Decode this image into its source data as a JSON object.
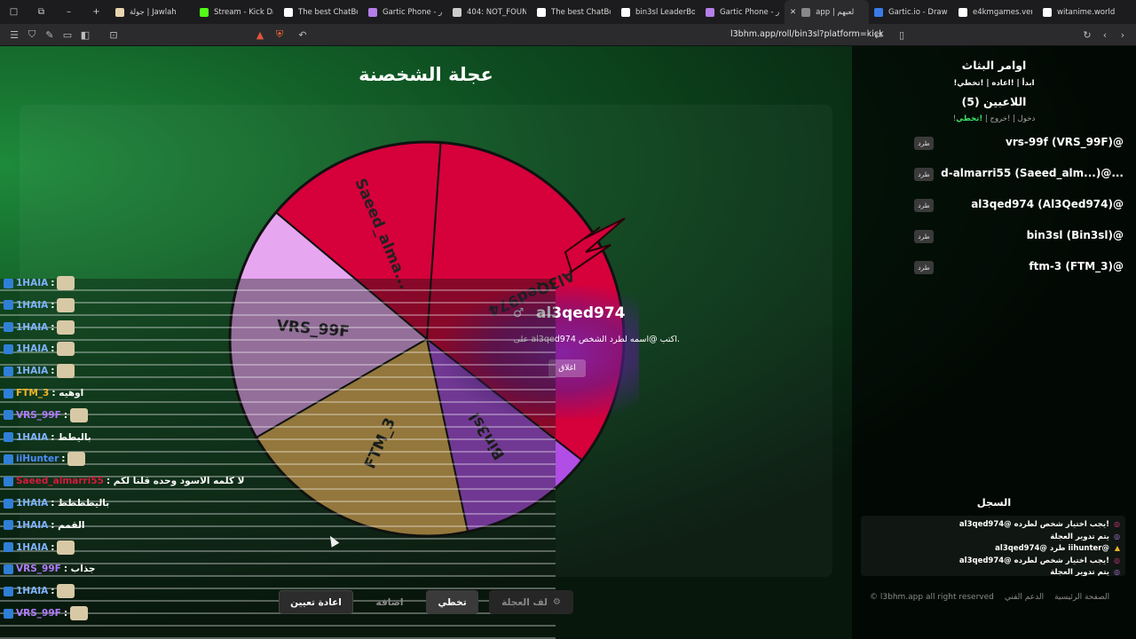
{
  "browser": {
    "tabs": [
      {
        "label": "جولة | Jawlah",
        "color": "#e8d4b0"
      },
      {
        "label": "Stream - Kick Da",
        "color": "#53fc18"
      },
      {
        "label": "The best ChatBot",
        "color": "#ffffff"
      },
      {
        "label": "Gartic Phone - ور",
        "color": "#b57ee8"
      },
      {
        "label": "404: NOT_FOUND",
        "color": "#cccccc"
      },
      {
        "label": "The best ChatBot",
        "color": "#ffffff"
      },
      {
        "label": "bin3sl LeaderBoa",
        "color": "#ffffff"
      },
      {
        "label": "Gartic Phone - ور",
        "color": "#b57ee8"
      },
      {
        "label": "app | لعبهم",
        "color": "#888888",
        "active": true
      },
      {
        "label": "Gartic.io - Draw,",
        "color": "#3a7be8"
      },
      {
        "label": "e4kmgames.verce",
        "color": "#ffffff"
      },
      {
        "label": "witanime.world",
        "color": "#ffffff"
      }
    ],
    "url": "l3bhm.app/roll/bin3sl?platform=kick"
  },
  "page": {
    "title": "عجلة الشخصنة",
    "winner": {
      "name": "al3qed974",
      "message": "على al3qed974 اكتب @اسمه لطرد الشخص.",
      "close_label": "اغلاق"
    },
    "buttons": {
      "reset": "اعادة تعيين",
      "add": "اضافه",
      "skip": "تخطي",
      "spin": "لف العجلة"
    }
  },
  "wheel": {
    "segments": [
      {
        "label": "Al3Qed974",
        "color": "#d6003b"
      },
      {
        "label": "Saeed_alma...",
        "color": "#d6003b"
      },
      {
        "label": "VRS_99F",
        "color": "#e7a6f0"
      },
      {
        "label": "FTM_3",
        "color": "#e8b45a"
      },
      {
        "label": "Bin3sl",
        "color": "#b04ee6"
      }
    ]
  },
  "sidebar": {
    "commands_title": "اوامر البثاث",
    "commands": "!ابدأ | !اعاده | !تخطي",
    "players_title": "اللاعبين (5)",
    "join_prefix": "!دخول | !خروج | ",
    "join_skip": "!تخطي",
    "kick_label": "طرد",
    "players": [
      "vrs-99f (VRS_99F)@",
      "d-almarri55 (Saeed_alm...)@...",
      "al3qed974 (Al3Qed974)@",
      "bin3sl (Bin3sl)@",
      "ftm-3 (FTM_3)@"
    ],
    "log_title": "السجل",
    "log": [
      "al3qed974@ يجب اختيار شخص لطرده!",
      "يتم تدوير العجلة",
      "al3qed974@ طرد iihunter@",
      "al3qed974@ يجب اختيار شخص لطرده!",
      "يتم تدوير العجلة"
    ],
    "footer": [
      "الصفحة الرئيسية",
      "الدعم الفني",
      "l3bhm.app all right reserved ©"
    ]
  },
  "chat": [
    {
      "user": "1HAIA",
      "text": ":",
      "color": "#7fb2ff"
    },
    {
      "user": "1HAIA",
      "text": ":",
      "color": "#7fb2ff"
    },
    {
      "user": "1HAIA",
      "text": ":",
      "color": "#7fb2ff"
    },
    {
      "user": "1HAIA",
      "text": ":",
      "color": "#7fb2ff"
    },
    {
      "user": "1HAIA",
      "text": ":",
      "color": "#7fb2ff"
    },
    {
      "user": "FTM_3",
      "text": ": اوهيه",
      "color": "#f0b429"
    },
    {
      "user": "VRS_99F",
      "text": ":",
      "color": "#b27aff"
    },
    {
      "user": "1HAIA",
      "text": ": باليطط",
      "color": "#7fb2ff"
    },
    {
      "user": "iiHunter",
      "text": ":",
      "color": "#4f8bff"
    },
    {
      "user": "Saeed_almarri55",
      "text": ": لا كلمه الاسود وحده قلنا لكم",
      "color": "#d41a3c"
    },
    {
      "user": "1HAIA",
      "text": ": باليطططط",
      "color": "#7fb2ff"
    },
    {
      "user": "1HAIA",
      "text": ": القمم",
      "color": "#7fb2ff"
    },
    {
      "user": "1HAIA",
      "text": ":",
      "color": "#7fb2ff"
    },
    {
      "user": "VRS_99F",
      "text": ": جذاب",
      "color": "#b27aff"
    },
    {
      "user": "1HAIA",
      "text": ":",
      "color": "#7fb2ff"
    },
    {
      "user": "VRS_99F",
      "text": ":",
      "color": "#b27aff"
    }
  ]
}
